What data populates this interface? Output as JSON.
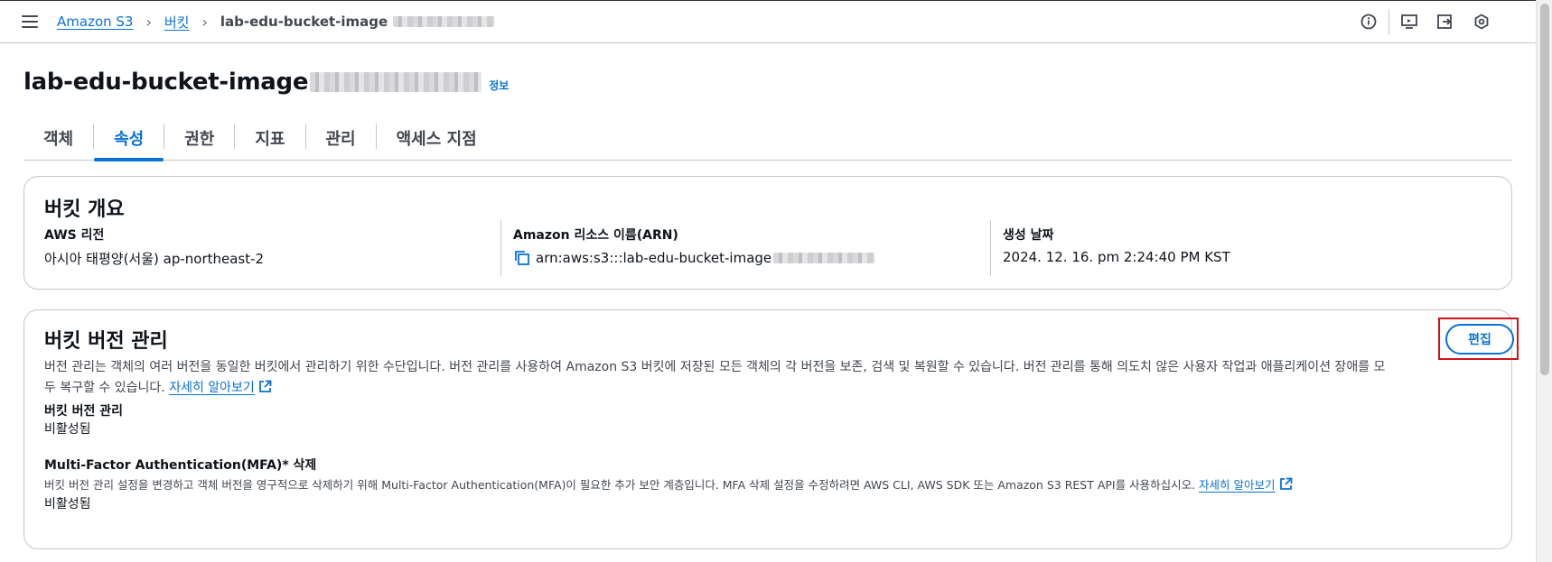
{
  "breadcrumbs": {
    "root": "Amazon S3",
    "buckets": "버킷",
    "current": "lab-edu-bucket-image"
  },
  "top_icons": [
    "info-icon",
    "screen-share-icon",
    "export-icon",
    "settings-hex-icon"
  ],
  "page": {
    "title": "lab-edu-bucket-image",
    "info_link": "정보"
  },
  "tabs": [
    {
      "label": "객체",
      "active": false
    },
    {
      "label": "속성",
      "active": true
    },
    {
      "label": "권한",
      "active": false
    },
    {
      "label": "지표",
      "active": false
    },
    {
      "label": "관리",
      "active": false
    },
    {
      "label": "액세스 지점",
      "active": false
    }
  ],
  "overview": {
    "title": "버킷 개요",
    "region_label": "AWS 리전",
    "region_value": "아시아 태평양(서울) ap-northeast-2",
    "arn_label": "Amazon 리소스 이름(ARN)",
    "arn_value": "arn:aws:s3:::lab-edu-bucket-image",
    "created_label": "생성 날짜",
    "created_value": "2024. 12. 16. pm 2:24:40 PM KST"
  },
  "versioning": {
    "title": "버킷 버전 관리",
    "edit_button": "편집",
    "description_line1": "버전 관리는 객체의 여러 버전을 동일한 버킷에서 관리하기 위한 수단입니다. 버전 관리를 사용하여 Amazon S3 버킷에 저장된 모든 객체의 각 버전을 보존, 검색 및 복원할 수 있습니다. 버전 관리를 통해 의도치 않은 사용자 작업과 애플리케이션 장애를 모",
    "description_line2": "두 복구할 수 있습니다.",
    "learn_more": "자세히 알아보기",
    "status_label": "버킷 버전 관리",
    "status_value": "비활성됨",
    "mfa_label": "Multi-Factor Authentication(MFA)* 삭제",
    "mfa_description": "버킷 버전 관리 설정을 변경하고 객체 버전을 영구적으로 삭제하기 위해 Multi-Factor Authentication(MFA)이 필요한 추가 보안 계층입니다. MFA 삭제 설정을 수정하려면 AWS CLI, AWS SDK 또는 Amazon S3 REST API를 사용하십시오.",
    "mfa_learn_more": "자세히 알아보기",
    "mfa_value": "비활성됨"
  },
  "colors": {
    "link": "#0972d3",
    "text": "#0f141a",
    "secondary_text": "#424650",
    "border": "#c6c6cd",
    "highlight": "#d0121a"
  }
}
